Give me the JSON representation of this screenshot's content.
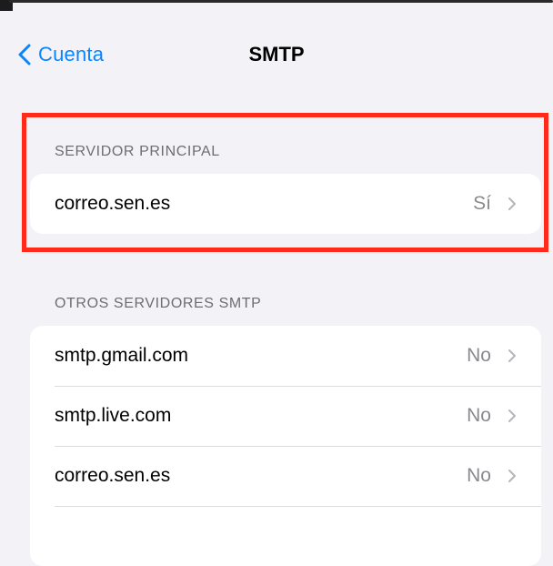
{
  "nav": {
    "back_label": "Cuenta",
    "title": "SMTP"
  },
  "primary": {
    "header": "SERVIDOR PRINCIPAL",
    "rows": [
      {
        "label": "correo.sen.es",
        "value": "Sí"
      }
    ]
  },
  "others": {
    "header": "OTROS SERVIDORES SMTP",
    "rows": [
      {
        "label": "smtp.gmail.com",
        "value": "No"
      },
      {
        "label": "smtp.live.com",
        "value": "No"
      },
      {
        "label": "correo.sen.es",
        "value": "No"
      }
    ]
  },
  "colors": {
    "accent": "#0a84ff",
    "highlight": "#ff2a1a",
    "background": "#f2f2f7"
  },
  "icons": {
    "back": "chevron-left-icon",
    "disclosure": "chevron-right-icon"
  }
}
